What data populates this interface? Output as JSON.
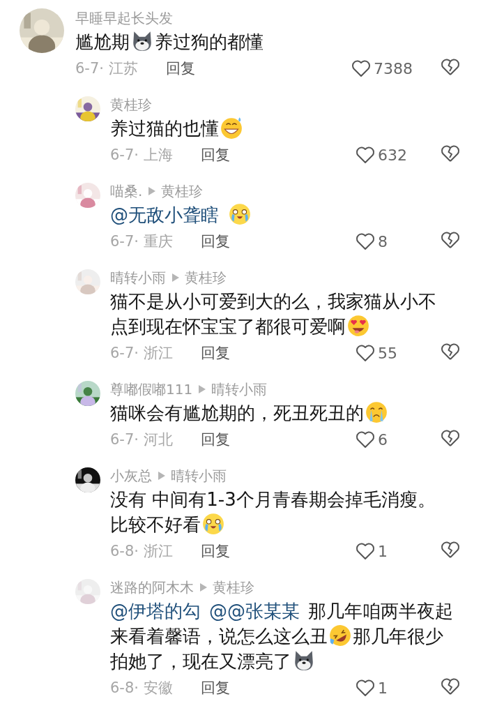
{
  "comment": {
    "author": "早睡早起长头发",
    "content": [
      {
        "kind": "text",
        "text": "尴尬期"
      },
      {
        "kind": "dog"
      },
      {
        "kind": "text",
        "text": "养过狗的都懂"
      }
    ],
    "meta": "6-7· 江苏",
    "reply_label": "回复",
    "likes": "7388",
    "replies": [
      {
        "author": "黄桂珍",
        "content": [
          {
            "kind": "text",
            "text": "养过猫的也懂"
          },
          {
            "kind": "sweat"
          }
        ],
        "meta": "6-7· 上海",
        "reply_label": "回复",
        "likes": "632"
      },
      {
        "author": "喵桑.",
        "reply_to": "黄桂珍",
        "content": [
          {
            "kind": "mention",
            "text": "@无敌小聋瞎"
          },
          {
            "kind": "tears"
          }
        ],
        "meta": "6-7· 重庆",
        "reply_label": "回复",
        "likes": "8"
      },
      {
        "author": "晴转小雨",
        "reply_to": "黄桂珍",
        "content": [
          {
            "kind": "text",
            "text": "猫不是从小可爱到大的么，我家猫从小不点到现在怀宝宝了都很可爱啊"
          },
          {
            "kind": "love"
          }
        ],
        "meta": "6-7· 浙江",
        "reply_label": "回复",
        "likes": "55"
      },
      {
        "author": "尊嘟假嘟111",
        "reply_to": "晴转小雨",
        "content": [
          {
            "kind": "text",
            "text": "猫咪会有尴尬期的，死丑死丑的"
          },
          {
            "kind": "sob"
          }
        ],
        "meta": "6-7· 河北",
        "reply_label": "回复",
        "likes": "6"
      },
      {
        "author": "小灰总",
        "reply_to": "晴转小雨",
        "content": [
          {
            "kind": "text",
            "text": "没有 中间有1-3个月青春期会掉毛消瘦。比较不好看"
          },
          {
            "kind": "tears"
          }
        ],
        "meta": "6-8· 浙江",
        "reply_label": "回复",
        "likes": "1"
      },
      {
        "author": "迷路的阿木木",
        "reply_to": "黄桂珍",
        "content": [
          {
            "kind": "mention",
            "text": "@伊塔的勾"
          },
          {
            "kind": "mention",
            "text": "@@张某某"
          },
          {
            "kind": "text",
            "text": "那几年咱两半夜起来看着馨语，说怎么这么丑"
          },
          {
            "kind": "rofl"
          },
          {
            "kind": "text",
            "text": "那几年很少拍她了，现在又漂亮了"
          },
          {
            "kind": "dog"
          }
        ],
        "meta": "6-8· 安徽",
        "reply_label": "回复",
        "likes": "1"
      }
    ]
  }
}
